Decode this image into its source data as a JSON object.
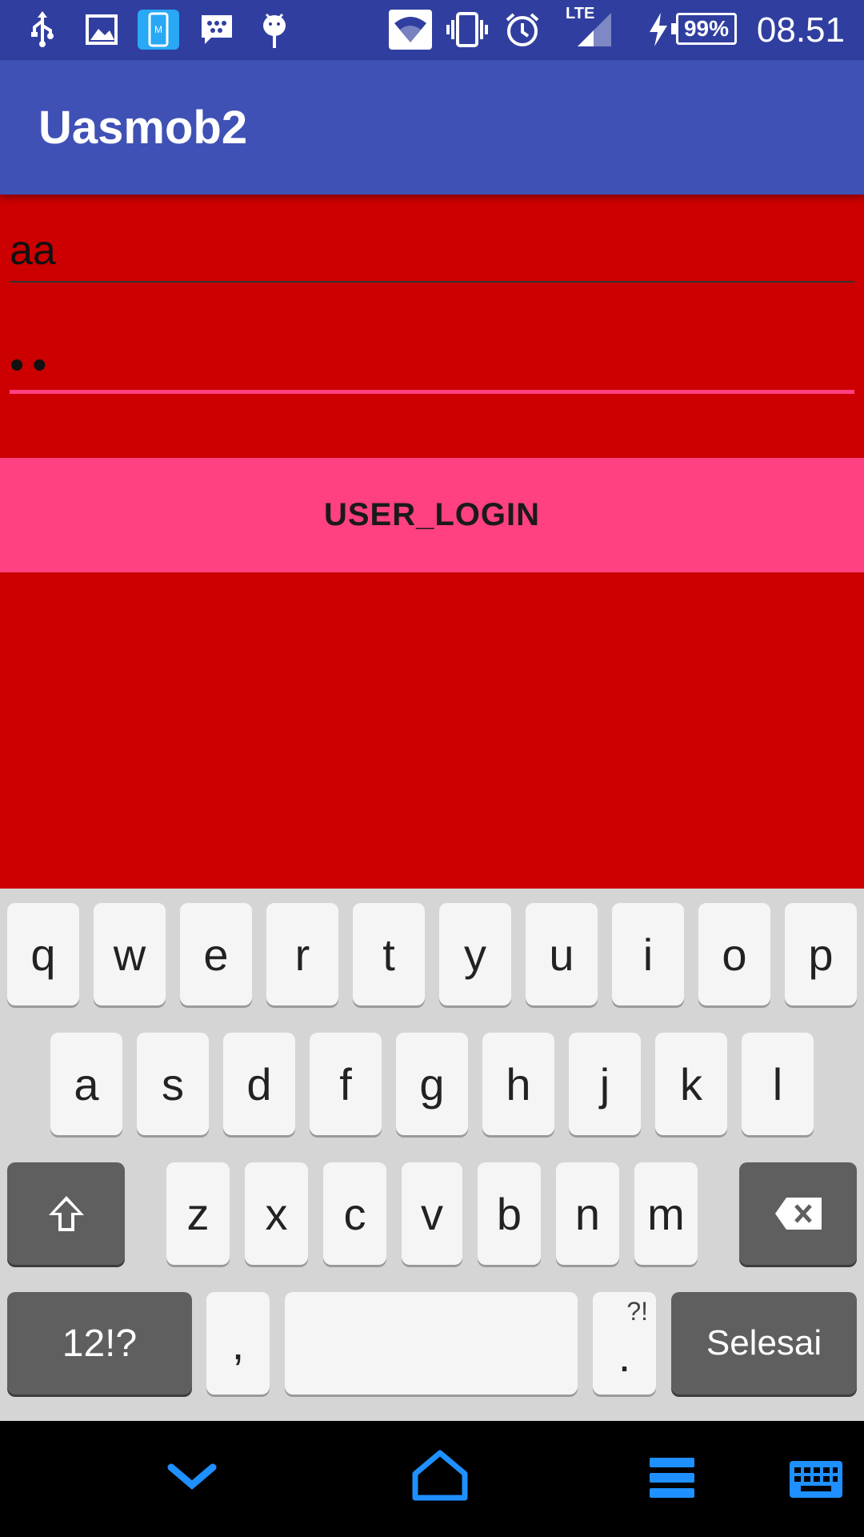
{
  "status_bar": {
    "time": "08.51",
    "battery": "99%",
    "network": "LTE",
    "icons": [
      "usb-icon",
      "image-icon",
      "mobile-app-icon",
      "bbm-chat-icon",
      "android-debug-icon",
      "wifi-icon",
      "vibrate-icon",
      "alarm-icon",
      "signal-icon",
      "charging-icon",
      "battery-icon"
    ]
  },
  "app_bar": {
    "title": "Uasmob2",
    "color": "#3f51b5"
  },
  "form": {
    "username_value": "aa",
    "password_value": "••",
    "login_label": "USER_LOGIN",
    "background": "#cc0000",
    "accent": "#ff4081"
  },
  "keyboard": {
    "row1": [
      "q",
      "w",
      "e",
      "r",
      "t",
      "y",
      "u",
      "i",
      "o",
      "p"
    ],
    "row2": [
      "a",
      "s",
      "d",
      "f",
      "g",
      "h",
      "j",
      "k",
      "l"
    ],
    "row3": [
      "z",
      "x",
      "c",
      "v",
      "b",
      "n",
      "m"
    ],
    "symbols_label": "12!?",
    "comma_label": ",",
    "period_label": ".",
    "period_alt": "?!",
    "done_label": "Selesai",
    "shift_icon": "shift-icon",
    "backspace_icon": "backspace-icon"
  },
  "nav_bar": {
    "icons": [
      "hide-keyboard-icon",
      "home-icon",
      "recent-apps-icon",
      "keyboard-switch-icon"
    ],
    "color": "#1e90ff"
  }
}
